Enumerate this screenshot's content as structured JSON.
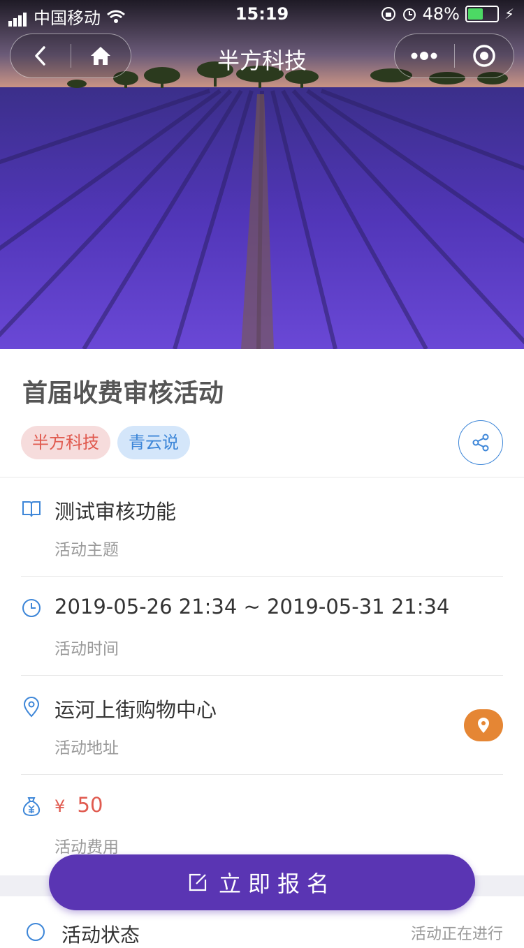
{
  "status_bar": {
    "carrier": "中国移动",
    "time": "15:19",
    "battery_pct": "48%",
    "battery_fraction": 0.48
  },
  "nav": {
    "title": "半方科技"
  },
  "activity": {
    "title": "首届收费审核活动",
    "tags": [
      "半方科技",
      "青云说"
    ],
    "theme": {
      "value": "测试审核功能",
      "label": "活动主题"
    },
    "time": {
      "value": "2019-05-26 21:34 ~ 2019-05-31 21:34",
      "label": "活动时间"
    },
    "address": {
      "value": "运河上街购物中心",
      "label": "活动地址"
    },
    "fee": {
      "currency": "¥",
      "value": "50",
      "label": "活动费用"
    },
    "status": {
      "label": "活动状态",
      "value": "活动正在进行"
    }
  },
  "signup_button": {
    "label": "立即报名"
  },
  "colors": {
    "accent": "#5a35b3",
    "tag_red": "#e05a4f",
    "tag_blue": "#3d86d8",
    "map_orange": "#e58634"
  },
  "icons": [
    "back-icon",
    "home-icon",
    "more-icon",
    "record-icon",
    "share-icon",
    "book-icon",
    "clock-icon",
    "location-icon",
    "money-bag-icon",
    "map-pin-icon",
    "edit-icon"
  ]
}
